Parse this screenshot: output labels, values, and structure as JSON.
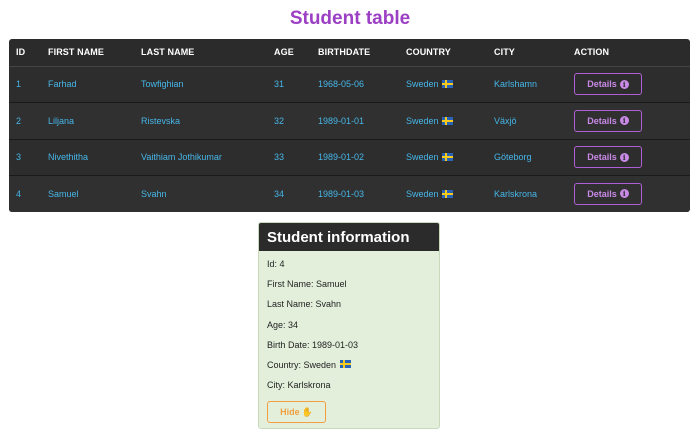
{
  "page": {
    "title": "Student table"
  },
  "table": {
    "headers": [
      "ID",
      "FIRST NAME",
      "LAST NAME",
      "AGE",
      "BIRTHDATE",
      "COUNTRY",
      "CITY",
      "ACTION"
    ],
    "rows": [
      {
        "id": "1",
        "first_name": "Farhad",
        "last_name": "Towfighian",
        "age": "31",
        "birthdate": "1968-05-06",
        "country": "Sweden",
        "city": "Karlshamn",
        "action": "Details"
      },
      {
        "id": "2",
        "first_name": "Liljana",
        "last_name": "Ristevska",
        "age": "32",
        "birthdate": "1989-01-01",
        "country": "Sweden",
        "city": "Växjö",
        "action": "Details"
      },
      {
        "id": "3",
        "first_name": "Nivethitha",
        "last_name": "Vaithiam Jothikumar",
        "age": "33",
        "birthdate": "1989-01-02",
        "country": "Sweden",
        "city": "Göteborg",
        "action": "Details"
      },
      {
        "id": "4",
        "first_name": "Samuel",
        "last_name": "Svahn",
        "age": "34",
        "birthdate": "1989-01-03",
        "country": "Sweden",
        "city": "Karlskrona",
        "action": "Details"
      }
    ],
    "country_flag_icon": "sweden-flag-icon",
    "action_icon": "info-icon"
  },
  "student_info": {
    "title": "Student information",
    "id_line": "Id: 4",
    "first_name_line": "First Name: Samuel",
    "last_name_line": "Last Name: Svahn",
    "age_line": "Age: 34",
    "birth_date_line": "Birth Date: 1989-01-03",
    "country_line": "Country: Sweden",
    "city_line": "City: Karlskrona",
    "hide_label": "Hide",
    "hide_icon": "hand-wave-icon"
  },
  "colors": {
    "title": "#9b3fc4",
    "table_bg": "#2b2b2b",
    "link_text": "#46b6e8",
    "details_button": "#b15fd6",
    "card_bg": "#e3efdb",
    "hide_button": "#f0a040"
  }
}
